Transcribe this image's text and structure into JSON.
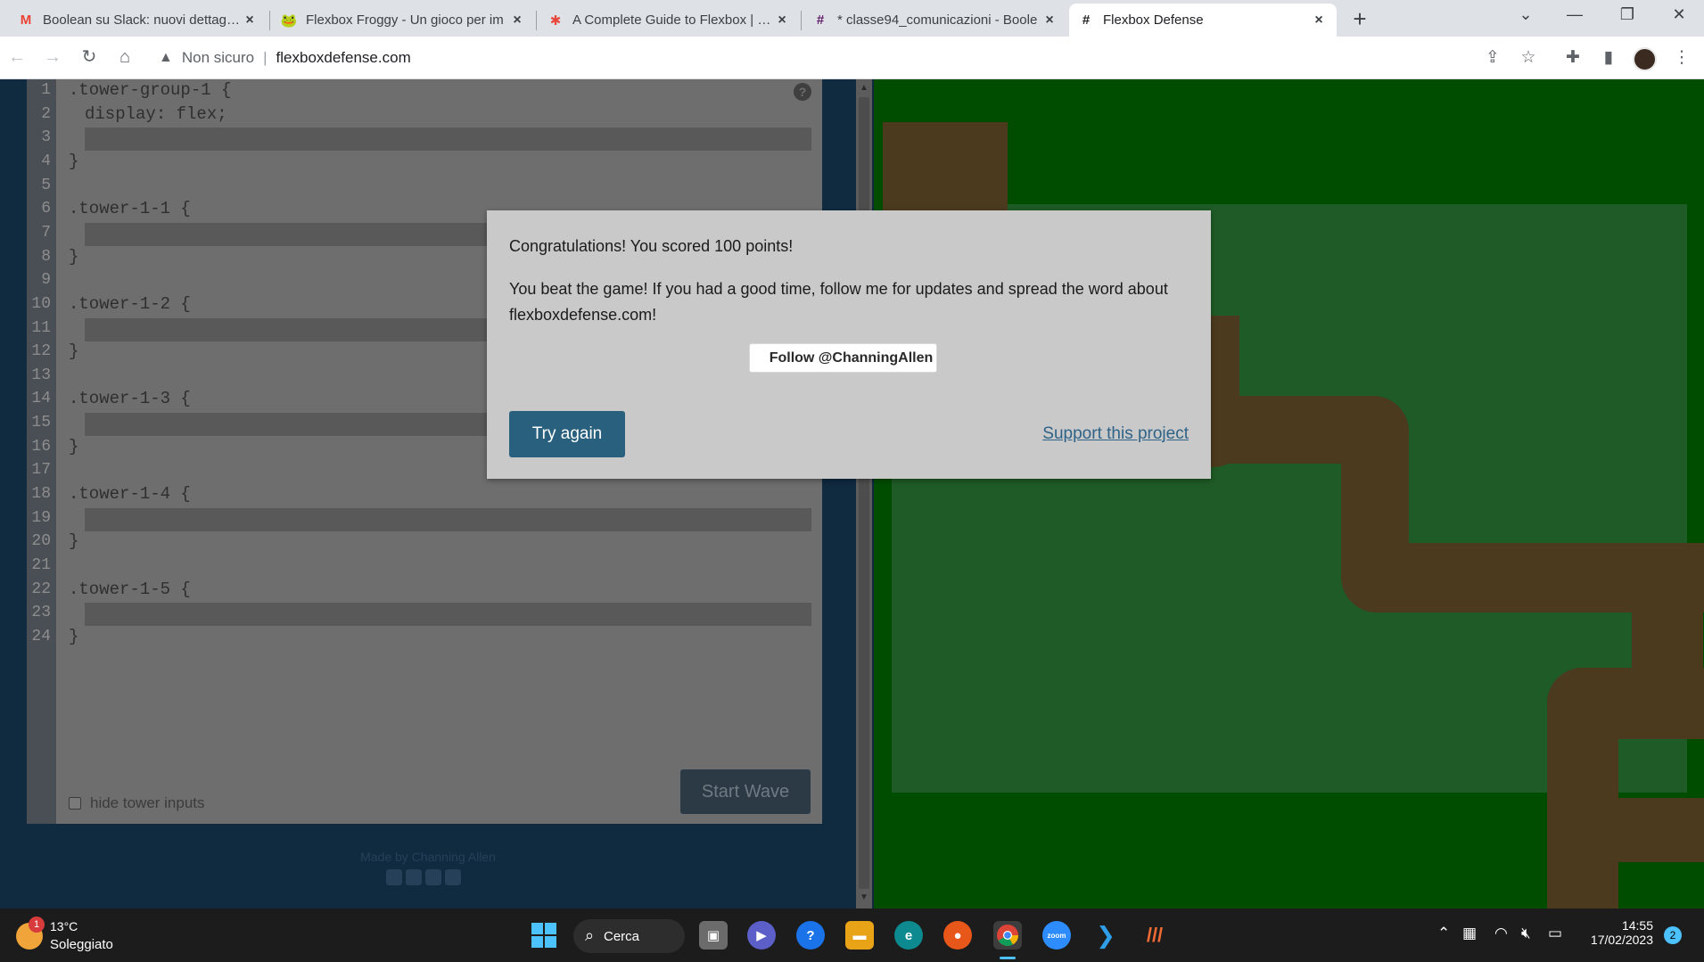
{
  "browser": {
    "tabs": [
      {
        "title": "Boolean su Slack: nuovi dettagli a",
        "icon": "gmail-icon"
      },
      {
        "title": "Flexbox Froggy - Un gioco per im",
        "icon": "frog-icon"
      },
      {
        "title": "A Complete Guide to Flexbox | CS",
        "icon": "css-tricks-icon"
      },
      {
        "title": "* classe94_comunicazioni - Boole",
        "icon": "slack-icon"
      },
      {
        "title": "Flexbox Defense",
        "icon": "hash-icon",
        "active": true
      }
    ],
    "address": {
      "security": "Non sicuro",
      "url": "flexboxdefense.com"
    }
  },
  "editor": {
    "lines": [
      {
        "n": "1",
        "text": ".tower-group-1 {"
      },
      {
        "n": "2",
        "text": "display: flex;"
      },
      {
        "n": "3",
        "text": ""
      },
      {
        "n": "4",
        "text": "}"
      },
      {
        "n": "5",
        "text": ""
      },
      {
        "n": "6",
        "text": ".tower-1-1 {"
      },
      {
        "n": "7",
        "text": ""
      },
      {
        "n": "8",
        "text": "}"
      },
      {
        "n": "9",
        "text": ""
      },
      {
        "n": "10",
        "text": ".tower-1-2 {"
      },
      {
        "n": "11",
        "text": ""
      },
      {
        "n": "12",
        "text": "}"
      },
      {
        "n": "13",
        "text": ""
      },
      {
        "n": "14",
        "text": ".tower-1-3 {"
      },
      {
        "n": "15",
        "text": ""
      },
      {
        "n": "16",
        "text": "}"
      },
      {
        "n": "17",
        "text": ""
      },
      {
        "n": "18",
        "text": ".tower-1-4 {"
      },
      {
        "n": "19",
        "text": ""
      },
      {
        "n": "20",
        "text": "}"
      },
      {
        "n": "21",
        "text": ""
      },
      {
        "n": "22",
        "text": ".tower-1-5 {"
      },
      {
        "n": "23",
        "text": ""
      },
      {
        "n": "24",
        "text": "}"
      }
    ],
    "hide_inputs_label": "hide tower inputs",
    "start_wave_label": "Start Wave",
    "help_label": "?"
  },
  "footer": {
    "credit": "Made by Channing Allen"
  },
  "modal": {
    "score_text": "Congratulations! You scored 100 points!",
    "beat_text": "You beat the game! If you had a good time, follow me for updates and spread the word about flexboxdefense.com!",
    "follow_label": "Follow @ChanningAllen",
    "try_again_label": "Try again",
    "support_label": "Support this project"
  },
  "taskbar": {
    "weather_temp": "13°C",
    "weather_cond": "Soleggiato",
    "weather_badge": "1",
    "search_label": "Cerca",
    "time": "14:55",
    "date": "17/02/2023",
    "notifications": "2"
  },
  "colors": {
    "board_bg": "#004d00",
    "field": "#1f5b26",
    "path": "#4b3a1d",
    "try_again": "#29607d",
    "editor_bg": "#6e6e6e"
  }
}
